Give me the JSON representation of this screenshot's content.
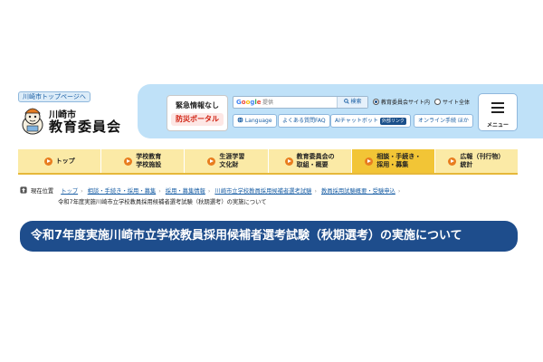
{
  "header": {
    "top_link": "川崎市トップページへ",
    "logo_city": "川崎市",
    "logo_board": "教育委員会",
    "emergency": {
      "status": "緊急情報なし",
      "portal": "防災ポータル"
    },
    "search": {
      "provider": "Google",
      "placeholder": "提供",
      "button": "検索"
    },
    "scope_options": [
      {
        "label": "教育委員会サイト内",
        "selected": true
      },
      {
        "label": "サイト全体",
        "selected": false
      }
    ],
    "quick_links": [
      {
        "label": "Language",
        "icon": "globe-icon"
      },
      {
        "label": "よくある質問FAQ",
        "icon": ""
      },
      {
        "label": "AIチャットボット",
        "badge": "外部リンク",
        "icon": ""
      },
      {
        "label": "オンライン手続 ほか",
        "icon": ""
      }
    ],
    "menu_label": "メニュー"
  },
  "nav": {
    "items": [
      {
        "label": "トップ",
        "active": false
      },
      {
        "label": "学校教育\n学校施設",
        "active": false
      },
      {
        "label": "生涯学習\n文化財",
        "active": false
      },
      {
        "label": "教育委員会の\n取組・概要",
        "active": false
      },
      {
        "label": "相談・手続き・\n採用・募集",
        "active": true
      },
      {
        "label": "広報（刊行物）\n統計",
        "active": false
      }
    ]
  },
  "breadcrumb": {
    "here_label": "現在位置",
    "links": [
      "トップ",
      "相談・手続き・採用・募集",
      "採用・募集情報",
      "川崎市立学校教員採用候補者選考試験",
      "教員採用試験概要・受験申込"
    ],
    "current": "令和7年度実施川崎市立学校教員採用候補者選考試験（秋期選考）の実施について"
  },
  "page": {
    "title": "令和7年度実施川崎市立学校教員採用候補者選考試験（秋期選考）の実施について"
  },
  "colors": {
    "header_panel": "#bfe1f8",
    "nav_bg": "#fbeaa6",
    "nav_active": "#f2c536",
    "nav_arrow": "#e87d1f",
    "title_bg": "#1e4d8c",
    "link": "#1a5fa5",
    "alert_red": "#d02010"
  }
}
